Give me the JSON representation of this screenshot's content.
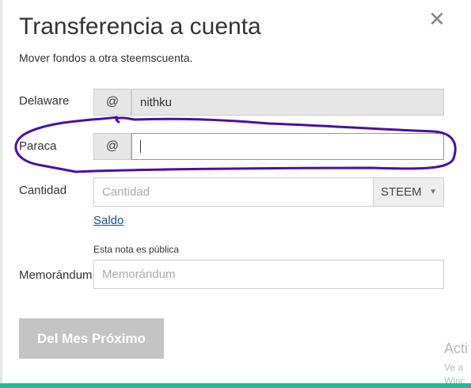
{
  "dialog": {
    "title": "Transferencia a cuenta",
    "subtitle": "Mover fondos a otra steemscuenta.",
    "close_glyph": "✕"
  },
  "form": {
    "from": {
      "label": "Delaware",
      "prefix": "@",
      "value": "nithku"
    },
    "to": {
      "label": "Paraca",
      "prefix": "@",
      "value": ""
    },
    "amount": {
      "label": "Cantidad",
      "placeholder": "Cantidad",
      "asset": "STEEM",
      "caret": "▼",
      "balance_link": "Saldo"
    },
    "memo": {
      "label": "Memorándum",
      "note": "Esta nota es pública",
      "placeholder": "Memorándum"
    },
    "submit_label": "Del Mes Próximo"
  },
  "annotation": {
    "color": "#4b0fa0"
  },
  "watermark": {
    "line1": "Acti",
    "line2": "Ve a",
    "line3": "Winc"
  }
}
